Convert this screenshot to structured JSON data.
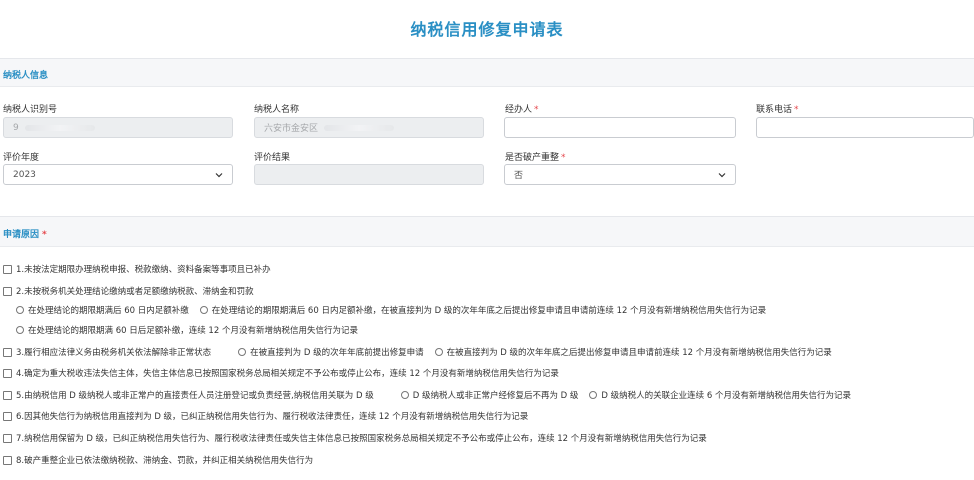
{
  "page_title": "纳税信用修复申请表",
  "taxpayer_section": {
    "title": "纳税人信息",
    "fields": {
      "id_label": "纳税人识别号",
      "id_value": "9",
      "name_label": "纳税人名称",
      "name_value": "六安市金安区",
      "handler_label": "经办人",
      "handler_required": "*",
      "handler_value": "",
      "phone_label": "联系电话",
      "phone_required": "*",
      "phone_value": "",
      "year_label": "评价年度",
      "year_value": "2023",
      "result_label": "评价结果",
      "result_value": "",
      "bankrupt_label": "是否破产重整",
      "bankrupt_required": "*",
      "bankrupt_value": "否"
    }
  },
  "reason_section": {
    "title": "申请原因",
    "required": "*",
    "items": [
      {
        "label": "1.未按法定期限办理纳税申报、税款缴纳、资料备案等事项且已补办"
      },
      {
        "label": "2.未按税务机关处理结论缴纳或者足额缴纳税款、滞纳金和罚款"
      },
      {
        "label": "3.履行相应法律义务由税务机关依法解除非正常状态"
      },
      {
        "label": "4.确定为重大税收违法失信主体，失信主体信息已按照国家税务总局相关规定不予公布或停止公布，连续 12 个月没有新增纳税信用失信行为记录"
      },
      {
        "label": "5.由纳税信用 D 级纳税人或非正常户的直接责任人员注册登记或负责经营,纳税信用关联为 D 级"
      },
      {
        "label": "6.因其他失信行为纳税信用直接判为 D 级，已纠正纳税信用失信行为、履行税收法律责任，连续 12 个月没有新增纳税信用失信行为记录"
      },
      {
        "label": "7.纳税信用保留为 D 级，已纠正纳税信用失信行为、履行税收法律责任或失信主体信息已按照国家税务总局相关规定不予公布或停止公布，连续 12 个月没有新增纳税信用失信行为记录"
      },
      {
        "label": "8.破产重整企业已依法缴纳税款、滞纳金、罚款，并纠正相关纳税信用失信行为"
      }
    ],
    "item2_options": [
      "在处理结论的期限期满后 60 日内足额补缴",
      "在处理结论的期限期满后 60 日内足额补缴，在被直接判为 D 级的次年年底之后提出修复申请且申请前连续 12 个月没有新增纳税信用失信行为记录",
      "在处理结论的期限期满 60 日后足额补缴，连续 12 个月没有新增纳税信用失信行为记录"
    ],
    "item3_options": [
      "在被直接判为 D 级的次年年底前提出修复申请",
      "在被直接判为 D 级的次年年底之后提出修复申请且申请前连续 12 个月没有新增纳税信用失信行为记录"
    ],
    "item5_options": [
      "D 级纳税人或非正常户经修复后不再为 D 级",
      "D 级纳税人的关联企业连续 6 个月没有新增纳税信用失信行为记录"
    ]
  }
}
